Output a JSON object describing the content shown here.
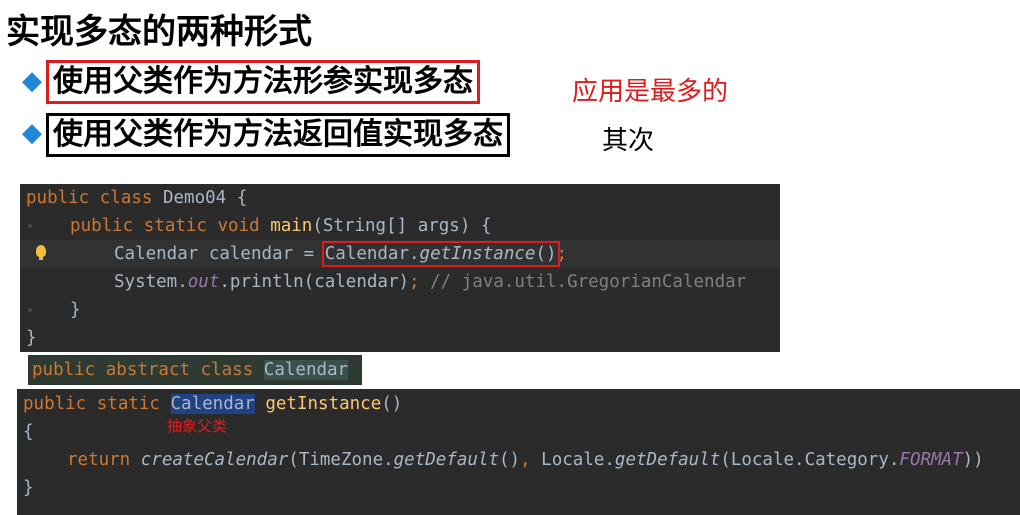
{
  "title": "实现多态的两种形式",
  "bullets": [
    {
      "text": "使用父类作为方法形参实现多态",
      "note": "应用是最多的"
    },
    {
      "text": "使用父类作为方法返回值实现多态",
      "note": "其次"
    }
  ],
  "colors": {
    "bullet_diamond": "#1e88d6",
    "note_red": "#e01b1b",
    "code_bg": "#2b2b2b",
    "keyword": "#cc7832",
    "method": "#ffc66d",
    "field": "#9876aa",
    "comment": "#808080",
    "selection": "#214283",
    "lightbulb": "#f2c035"
  },
  "icons": {
    "bullet": "diamond-icon",
    "gutter": "lightbulb-icon"
  },
  "code1": {
    "l1": {
      "kw": "public class ",
      "name": "Demo04 {"
    },
    "l2": {
      "kw": "public static void ",
      "fn": "main",
      "rest": "(String[] args) {"
    },
    "l3": {
      "pre": "Calendar calendar = ",
      "cls": "Calendar.",
      "call": "getInstance",
      "paren": "()",
      "semi": ";"
    },
    "l4": {
      "pre": "System.",
      "field": "out",
      "mid": ".println(calendar)",
      "semi": "; ",
      "comment": "// java.util.GregorianCalendar"
    },
    "l5": "}",
    "l6": "}"
  },
  "code2": {
    "kw": "public abstract class ",
    "name": "Calendar"
  },
  "code3": {
    "l1": {
      "kw": "public static ",
      "sel": "Calendar",
      "sp": " ",
      "fn": "getInstance",
      "rest": "()"
    },
    "l2": "{",
    "annotation": "抽象父类",
    "l3": {
      "kw": "return ",
      "call": "createCalendar",
      "a": "(TimeZone.",
      "b": "getDefault",
      "c": "()",
      "d": ", ",
      "e": "Locale.",
      "f": "getDefault",
      "g": "(Locale.Category.",
      "h": "FORMAT",
      "i": "))"
    },
    "l4": "}"
  }
}
